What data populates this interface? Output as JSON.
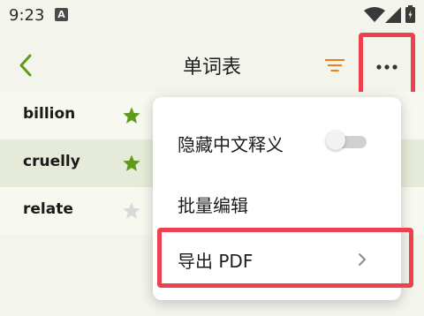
{
  "status_bar": {
    "time": "9:23",
    "notification_glyph": "A",
    "icons": [
      "a-notification-icon",
      "wifi-icon",
      "signal-icon",
      "battery-icon"
    ]
  },
  "app_bar": {
    "title": "单词表",
    "back_icon": "chevron-left-icon",
    "filter_icon": "filter-icon",
    "more_icon": "more-horizontal-icon"
  },
  "word_list": [
    {
      "word": "billion",
      "starred": true
    },
    {
      "word": "cruelly",
      "starred": true
    },
    {
      "word": "relate",
      "starred": false
    }
  ],
  "menu": {
    "hide_chinese_label": "隐藏中文释义",
    "hide_chinese_enabled": false,
    "batch_edit_label": "批量编辑",
    "export_pdf_label": "导出 PDF"
  },
  "colors": {
    "accent_green": "#5f9a1a",
    "accent_orange": "#f07c1c",
    "highlight_red": "#ef4050",
    "star_inactive": "#d9d9d9"
  }
}
